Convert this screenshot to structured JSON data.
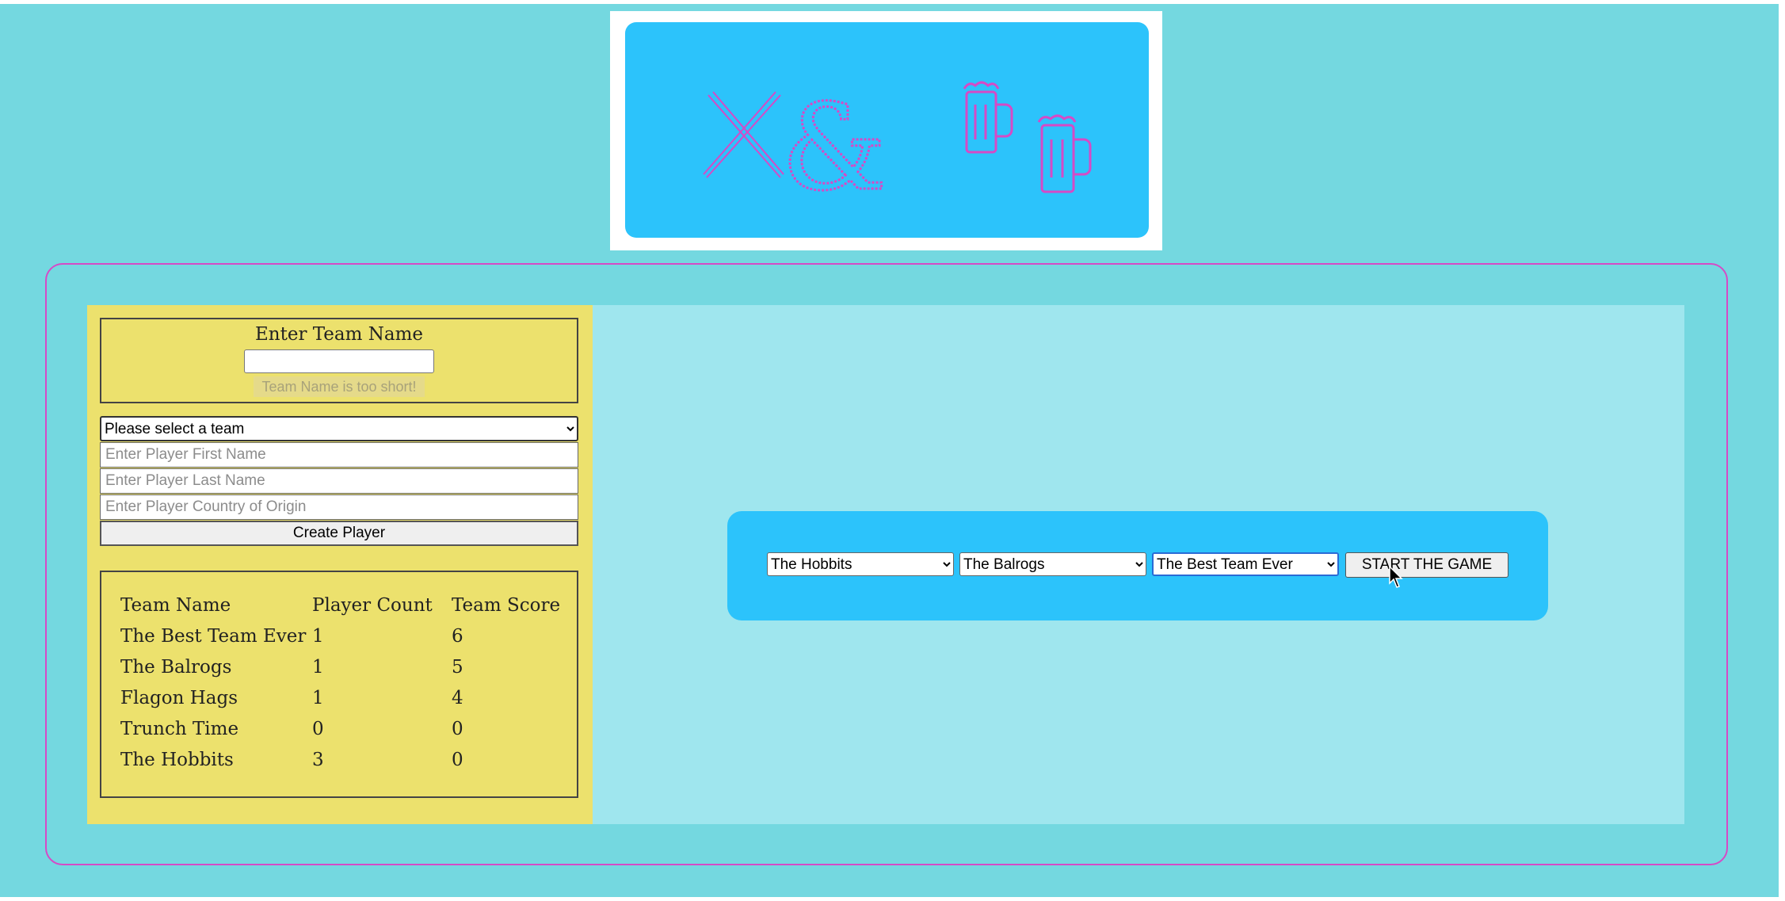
{
  "logo": {
    "icons": [
      "crossed-swords-icon",
      "ampersand-icon",
      "beer-mug-icon",
      "beer-mug-icon"
    ],
    "glyph": "&",
    "colors": {
      "frame": "#ffffff",
      "background": "#2cc3fb",
      "stroke": "#d64ac6"
    }
  },
  "team_form": {
    "title": "Enter Team Name",
    "input_value": "",
    "error": "Team Name is too short!"
  },
  "player_form": {
    "team_select_value": "Please select a team",
    "first_name_placeholder": "Enter Player First Name",
    "last_name_placeholder": "Enter Player Last Name",
    "country_placeholder": "Enter Player Country of Origin",
    "create_label": "Create Player"
  },
  "scoreboard": {
    "headers": [
      "Team Name",
      "Player Count",
      "Team Score"
    ],
    "rows": [
      [
        "The Best Team Ever",
        "1",
        "6"
      ],
      [
        "The Balrogs",
        "1",
        "5"
      ],
      [
        "Flagon Hags",
        "1",
        "4"
      ],
      [
        "Trunch Time",
        "0",
        "0"
      ],
      [
        "The Hobbits",
        "3",
        "0"
      ]
    ]
  },
  "game": {
    "select_1": "The Hobbits",
    "select_2": "The Balrogs",
    "select_3": "The Best Team Ever",
    "start_label": "START THE GAME"
  },
  "colors": {
    "page": "#74d8e0",
    "sidebar": "#ece16d",
    "game_area": "#9fe6ee",
    "accent_blue": "#2cc3fb",
    "accent_pink": "#d64ac6"
  }
}
